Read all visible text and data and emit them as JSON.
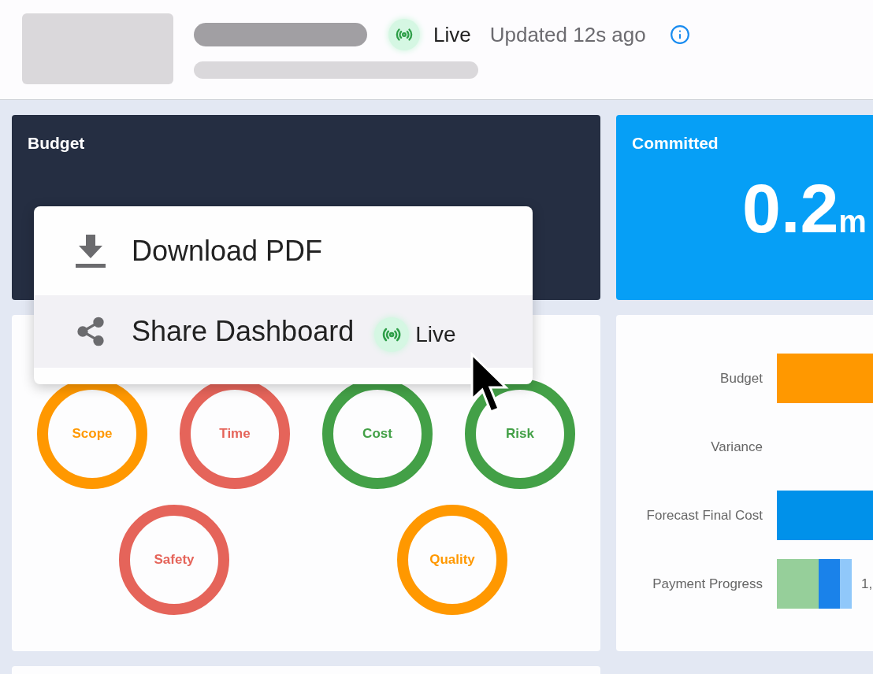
{
  "header": {
    "live_badge": {
      "label": "Live"
    },
    "updated": "Updated 12s ago"
  },
  "kpi_cards": [
    {
      "title": "Budget",
      "kind": "dark"
    },
    {
      "title": "Committed",
      "kind": "blue",
      "value": "0.2",
      "unit": "m"
    }
  ],
  "status_rings": [
    {
      "label": "Scope",
      "color": "#ff9800"
    },
    {
      "label": "Time",
      "color": "#e5645a"
    },
    {
      "label": "Cost",
      "color": "#43a047"
    },
    {
      "label": "Risk",
      "color": "#43a047"
    },
    {
      "label": "Safety",
      "color": "#e5645a"
    },
    {
      "label": "Quality",
      "color": "#ff9800"
    }
  ],
  "bar_rows": [
    {
      "label": "Budget",
      "segments": [
        {
          "color": "#ff9800",
          "kind": "full"
        }
      ]
    },
    {
      "label": "Variance"
    },
    {
      "label": "Forecast Final Cost",
      "segments": [
        {
          "color": "#0091ea",
          "kind": "full"
        }
      ]
    },
    {
      "label": "Payment Progress",
      "segments": [
        {
          "color": "#96cf9a",
          "kind": "large"
        },
        {
          "color": "#1a82ea",
          "kind": "medium"
        },
        {
          "color": "#90c8fa",
          "kind": "small"
        }
      ],
      "reading": "1,"
    }
  ],
  "menu": {
    "items": [
      {
        "kind": "download",
        "label": "Download PDF",
        "selected": false
      },
      {
        "kind": "share",
        "label": "Share Dashboard",
        "selected": true,
        "badge": "Live"
      }
    ]
  }
}
